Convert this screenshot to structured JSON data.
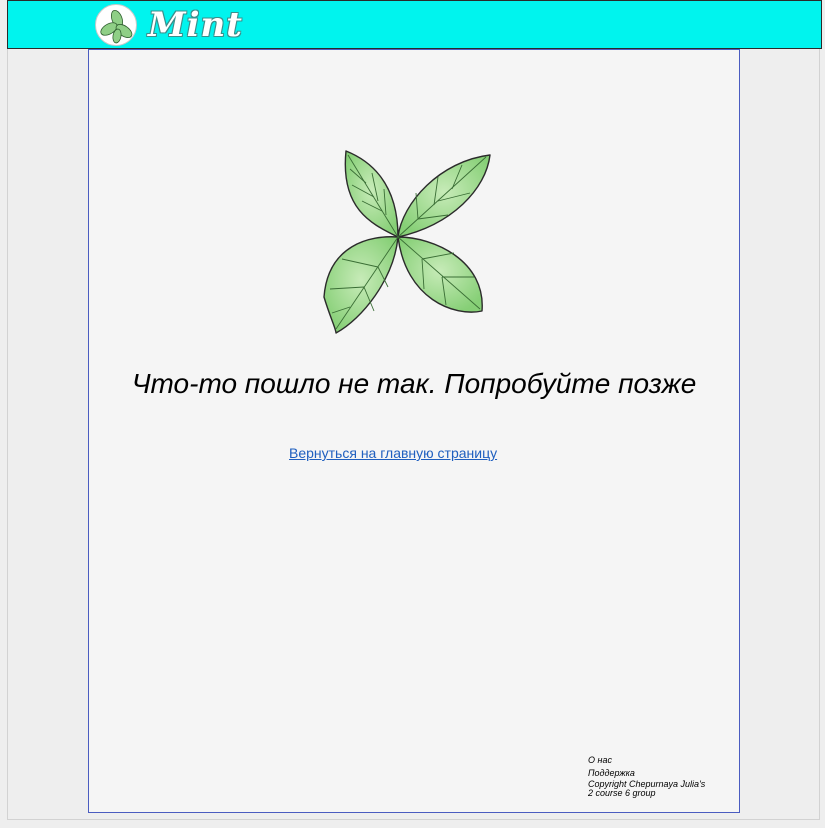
{
  "header": {
    "logo_text": "Mint",
    "background_color": "#00f4ee",
    "logo_icon": "mint-leaf-icon"
  },
  "main": {
    "illustration": "mint-leaves-image",
    "error_message": "Что-то пошло не так. Попробуйте позже",
    "home_link": "Вернуться на главную страницу",
    "link_color": "#1f5fbf"
  },
  "footer": {
    "about": "О нас",
    "support": "Поддержка",
    "copyright_line1": "Copyright Chepurnaya Julia's",
    "copyright_line2": "2 course 6 group"
  }
}
